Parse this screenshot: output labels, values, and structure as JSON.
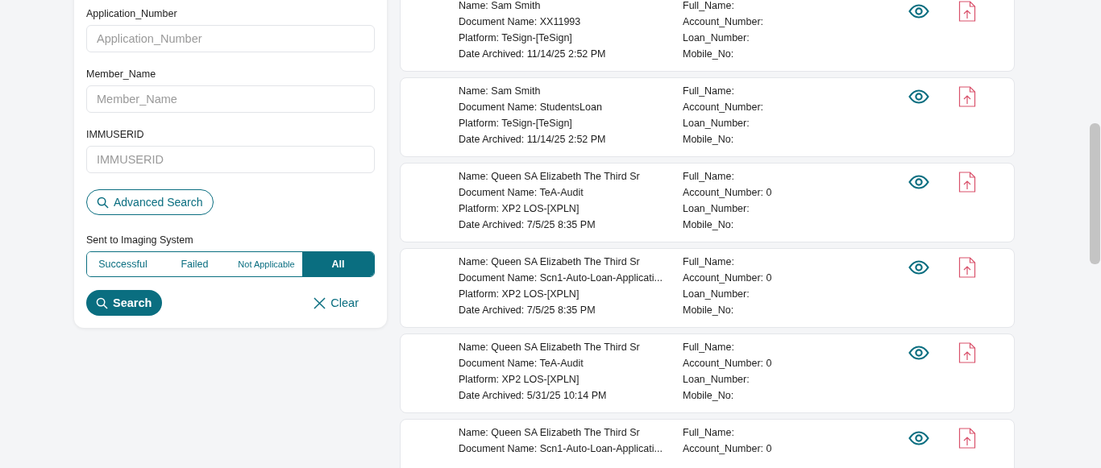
{
  "filters": {
    "fields": [
      {
        "label": "Application_Number",
        "placeholder": "Application_Number"
      },
      {
        "label": "Member_Name",
        "placeholder": "Member_Name"
      },
      {
        "label": "IMMUSERID",
        "placeholder": "IMMUSERID"
      }
    ],
    "advanced_search": "Advanced Search",
    "imaging": {
      "label": "Sent to Imaging System",
      "options": [
        {
          "label": "Successful",
          "selected": false
        },
        {
          "label": "Failed",
          "selected": false
        },
        {
          "label": "Not Applicable",
          "selected": false
        },
        {
          "label": "All",
          "selected": true
        }
      ]
    },
    "search_button": "Search",
    "clear_button": "Clear"
  },
  "records": [
    {
      "details": [
        "Name: Sam Smith",
        "Document Name: XX11993",
        "Platform: TeSign-[TeSign]",
        "Date Archived: 11/14/25 2:52 PM"
      ],
      "fields": [
        "Full_Name:",
        "Account_Number:",
        "Loan_Number:",
        "Mobile_No:"
      ]
    },
    {
      "details": [
        "Name: Sam Smith",
        "Document Name: StudentsLoan",
        "Platform: TeSign-[TeSign]",
        "Date Archived: 11/14/25 2:52 PM"
      ],
      "fields": [
        "Full_Name:",
        "Account_Number:",
        "Loan_Number:",
        "Mobile_No:"
      ]
    },
    {
      "details": [
        "Name: Queen SA Elizabeth The Third Sr",
        "Document Name: TeA-Audit",
        "Platform: XP2 LOS-[XPLN]",
        "Date Archived: 7/5/25 8:35 PM"
      ],
      "fields": [
        "Full_Name:",
        "Account_Number: 0",
        "Loan_Number:",
        "Mobile_No:"
      ]
    },
    {
      "details": [
        "Name: Queen SA Elizabeth The Third Sr",
        "Document Name: Scn1-Auto-Loan-Applicati...",
        "Platform: XP2 LOS-[XPLN]",
        "Date Archived: 7/5/25 8:35 PM"
      ],
      "fields": [
        "Full_Name:",
        "Account_Number: 0",
        "Loan_Number:",
        "Mobile_No:"
      ]
    },
    {
      "details": [
        "Name: Queen SA Elizabeth The Third Sr",
        "Document Name: TeA-Audit",
        "Platform: XP2 LOS-[XPLN]",
        "Date Archived: 5/31/25 10:14 PM"
      ],
      "fields": [
        "Full_Name:",
        "Account_Number: 0",
        "Loan_Number:",
        "Mobile_No:"
      ]
    },
    {
      "details": [
        "Name: Queen SA Elizabeth The Third Sr",
        "Document Name: Scn1-Auto-Loan-Applicati..."
      ],
      "fields": [
        "Full_Name:",
        "Account_Number: 0"
      ]
    }
  ]
}
